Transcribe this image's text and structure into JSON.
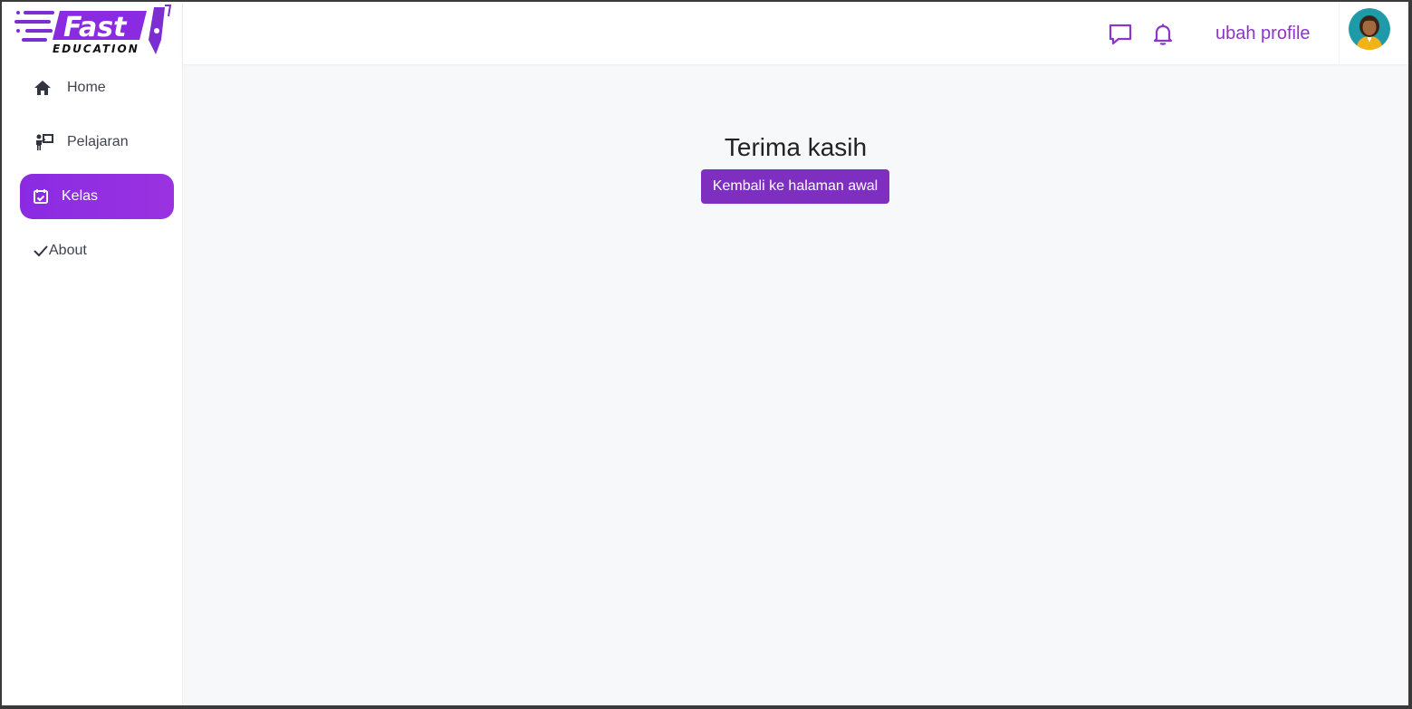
{
  "brand": {
    "name": "Fast",
    "tagline": "EDUCATION",
    "accent": "#8a2be2"
  },
  "sidebar": {
    "items": [
      {
        "label": "Home",
        "icon": "home-icon",
        "active": false
      },
      {
        "label": "Pelajaran",
        "icon": "teacher-board-icon",
        "active": false
      },
      {
        "label": "Kelas",
        "icon": "calendar-check-icon",
        "active": true
      },
      {
        "label": "About",
        "icon": "check-icon",
        "active": false
      }
    ]
  },
  "header": {
    "icons": [
      "chat-icon",
      "bell-icon"
    ],
    "profile_link": "ubah profile"
  },
  "main": {
    "title": "Terima kasih",
    "button_label": "Kembali ke halaman awal"
  }
}
